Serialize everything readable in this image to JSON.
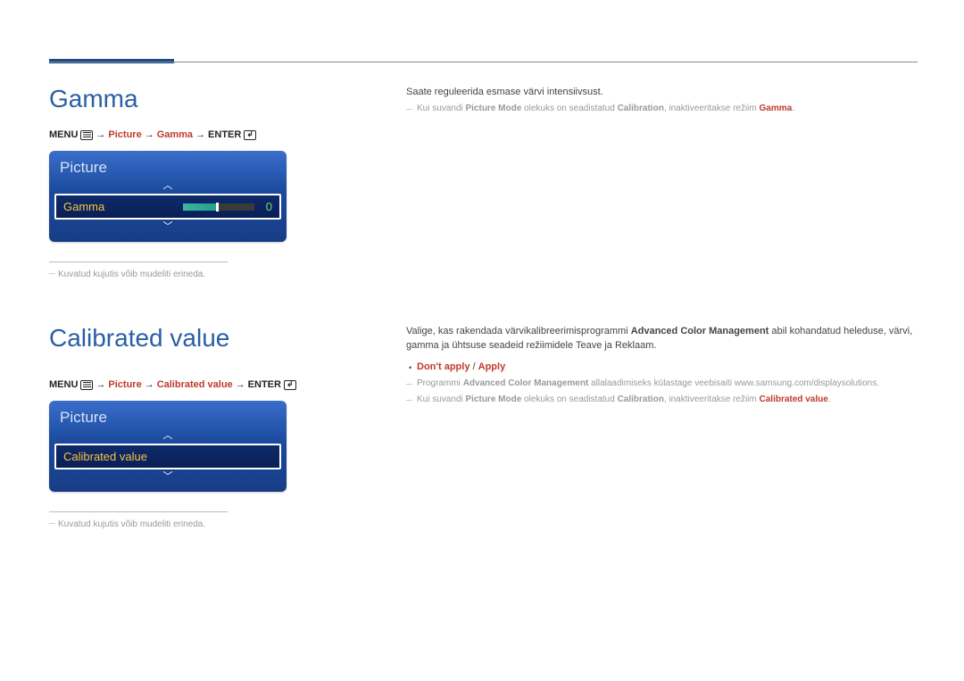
{
  "section1": {
    "title": "Gamma",
    "nav": {
      "menu": "MENU",
      "first": "Picture",
      "second": "Gamma",
      "enter": "ENTER"
    },
    "osd": {
      "header": "Picture",
      "row_label": "Gamma",
      "value": "0"
    },
    "footnote": "Kuvatud kujutis võib mudeliti erineda.",
    "right": {
      "intro": "Saate reguleerida esmase värvi intensiivsust.",
      "note1_pre": "Kui suvandi ",
      "note1_b1": "Picture Mode",
      "note1_mid": " olekuks on seadistatud ",
      "note1_b2": "Calibration",
      "note1_post": ", inaktiveeritakse režiim ",
      "note1_hl": "Gamma",
      "note1_end": "."
    }
  },
  "section2": {
    "title": "Calibrated value",
    "nav": {
      "menu": "MENU",
      "first": "Picture",
      "second": "Calibrated value",
      "enter": "ENTER"
    },
    "osd": {
      "header": "Picture",
      "row_label": "Calibrated value"
    },
    "footnote": "Kuvatud kujutis võib mudeliti erineda.",
    "right": {
      "intro1": "Valige, kas rakendada värvikalibreerimisprogrammi ",
      "intro_b": "Advanced Color Management",
      "intro2": " abil kohandatud heleduse, värvi, gamma ja ühtsuse seadeid režiimidele Teave ja Reklaam.",
      "opt1": "Don't apply",
      "opt_sep": " / ",
      "opt2": "Apply",
      "note1_pre": "Programmi ",
      "note1_b": "Advanced Color Management",
      "note1_post": " allalaadimiseks külastage veebisaiti www.samsung.com/displaysolutions.",
      "note2_pre": "Kui suvandi ",
      "note2_b1": "Picture Mode",
      "note2_mid": " olekuks on seadistatud ",
      "note2_b2": "Calibration",
      "note2_post": ", inaktiveeritakse režiim ",
      "note2_hl": "Calibrated value",
      "note2_end": "."
    }
  }
}
